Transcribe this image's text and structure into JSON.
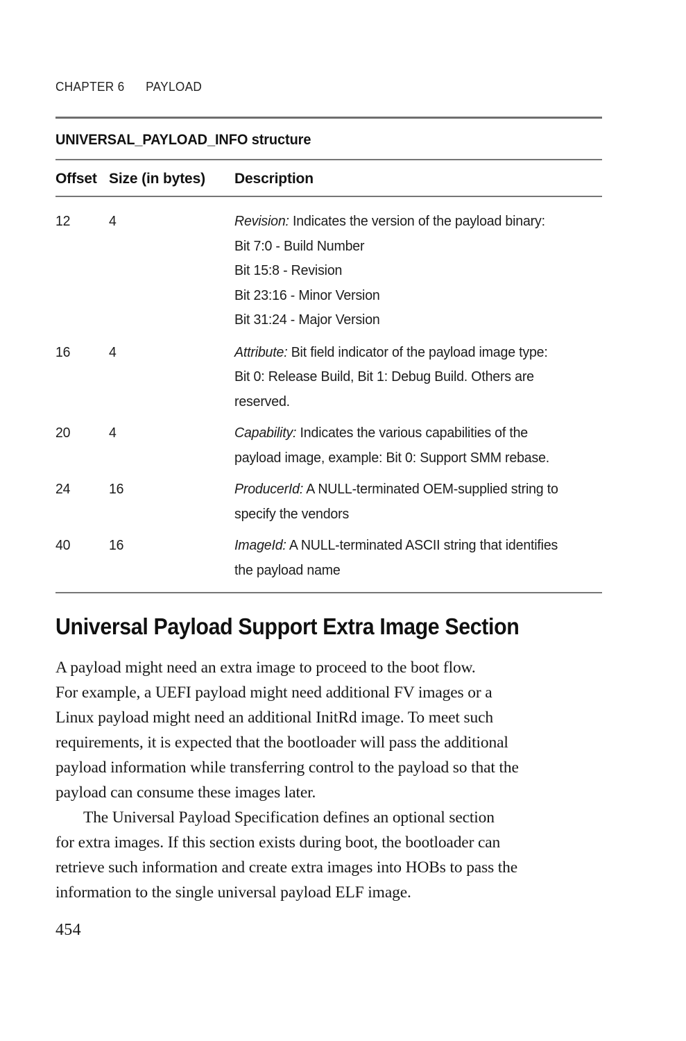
{
  "running_header": "CHAPTER 6      PAYLOAD",
  "table": {
    "caption": "UNIVERSAL_PAYLOAD_INFO structure",
    "columns": {
      "offset": "Offset",
      "size": "Size (in bytes)",
      "description": "Description"
    },
    "rows": [
      {
        "offset": "12",
        "size": "4",
        "field": "Revision:",
        "lines": [
          " Indicates the version of the payload binary:",
          "Bit 7:0 - Build Number",
          "Bit 15:8 - Revision",
          "Bit 23:16 - Minor Version",
          "Bit 31:24 - Major Version"
        ]
      },
      {
        "offset": "16",
        "size": "4",
        "field": "Attribute:",
        "lines": [
          " Bit field indicator of the payload image type:",
          "Bit 0: Release Build, Bit 1: Debug Build. Others are",
          "reserved."
        ]
      },
      {
        "offset": "20",
        "size": "4",
        "field": "Capability:",
        "lines": [
          " Indicates the various capabilities of the",
          "payload image, example: Bit 0: Support SMM rebase."
        ]
      },
      {
        "offset": "24",
        "size": "16",
        "field": "ProducerId:",
        "lines": [
          " A NULL-terminated OEM-supplied string to",
          "specify the vendors"
        ]
      },
      {
        "offset": "40",
        "size": "16",
        "field": "ImageId:",
        "lines": [
          " A NULL-terminated ASCII string that identifies",
          "the payload name"
        ]
      }
    ]
  },
  "section": {
    "heading": "Universal Payload Support Extra Image Section",
    "paragraphs": [
      {
        "indented": false,
        "lines": [
          "A payload might need an extra image to proceed to the boot flow.",
          "For example, a UEFI payload might need additional FV images or a",
          "Linux payload might need an additional InitRd image. To meet such",
          "requirements, it is expected that the bootloader will pass the additional",
          "payload information while transferring control to the payload so that the",
          "payload can consume these images later."
        ]
      },
      {
        "indented": true,
        "lines": [
          "The Universal Payload Specification defines an optional section",
          "for extra images. If this section exists during boot, the bootloader can",
          "retrieve such information and create extra images into HOBs to pass the",
          "information to the single universal payload ELF image."
        ]
      }
    ]
  },
  "page_number": "454",
  "colors": {
    "text": "#1a1a1a",
    "rule": "#6e6e6e",
    "background": "#ffffff"
  }
}
